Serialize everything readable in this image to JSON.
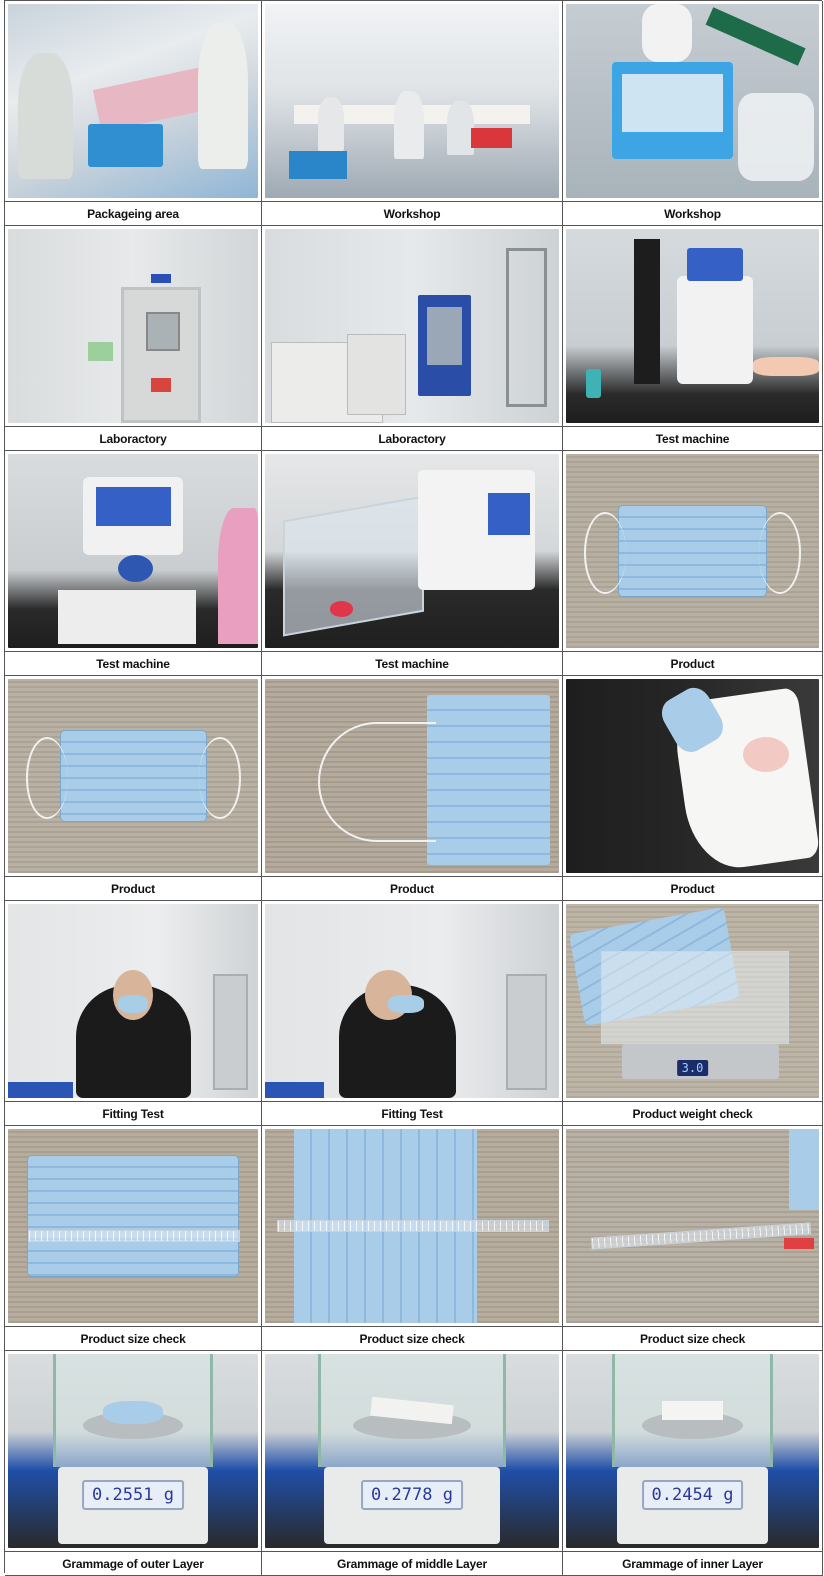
{
  "cells": [
    {
      "caption": "Packageing area"
    },
    {
      "caption": "Workshop"
    },
    {
      "caption": "Workshop"
    },
    {
      "caption": "Laboractory"
    },
    {
      "caption": "Laboractory"
    },
    {
      "caption": "Test machine"
    },
    {
      "caption": "Test machine"
    },
    {
      "caption": "Test machine"
    },
    {
      "caption": "Product"
    },
    {
      "caption": "Product"
    },
    {
      "caption": "Product"
    },
    {
      "caption": "Product"
    },
    {
      "caption": "Fitting Test"
    },
    {
      "caption": "Fitting Test"
    },
    {
      "caption": "Product weight check",
      "display": "3.0"
    },
    {
      "caption": "Product size check"
    },
    {
      "caption": "Product size check"
    },
    {
      "caption": "Product size check"
    },
    {
      "caption": "Grammage of outer Layer",
      "display": "0.2551 g"
    },
    {
      "caption": "Grammage of middle Layer",
      "display": "0.2778 g"
    },
    {
      "caption": "Grammage of inner Layer",
      "display": "0.2454 g"
    }
  ],
  "colors": {
    "border": "#555555",
    "cleanroom_wall": "#e6e8ea",
    "mask_blue": "#a9cde9",
    "table_surface": "#b9ae9d",
    "balance_blue": "#1f4fa8"
  }
}
